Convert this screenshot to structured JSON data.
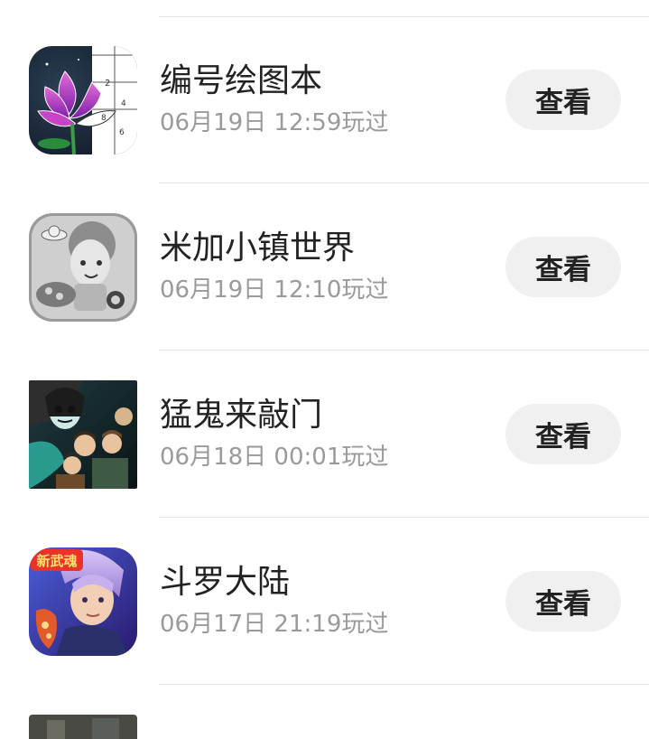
{
  "list": {
    "items": [
      {
        "title": "编号绘图本",
        "subtitle": "06月19日 12:59玩过",
        "button_label": "查看",
        "icon": "lotus-coloring-icon"
      },
      {
        "title": "米加小镇世界",
        "subtitle": "06月19日 12:10玩过",
        "button_label": "查看",
        "icon": "toca-world-grayscale-icon"
      },
      {
        "title": "猛鬼来敲门",
        "subtitle": "06月18日 00:01玩过",
        "button_label": "查看",
        "icon": "ghost-knock-icon"
      },
      {
        "title": "斗罗大陆",
        "subtitle": "06月17日 21:19玩过",
        "button_label": "查看",
        "icon": "douluo-hero-icon",
        "icon_badge": "新武魂"
      },
      {
        "icon": "partial-game-icon"
      }
    ]
  },
  "colors": {
    "title": "#222222",
    "subtitle": "#9a9a9a",
    "button_bg": "#f0f0f0",
    "divider": "#e8e8e8"
  }
}
